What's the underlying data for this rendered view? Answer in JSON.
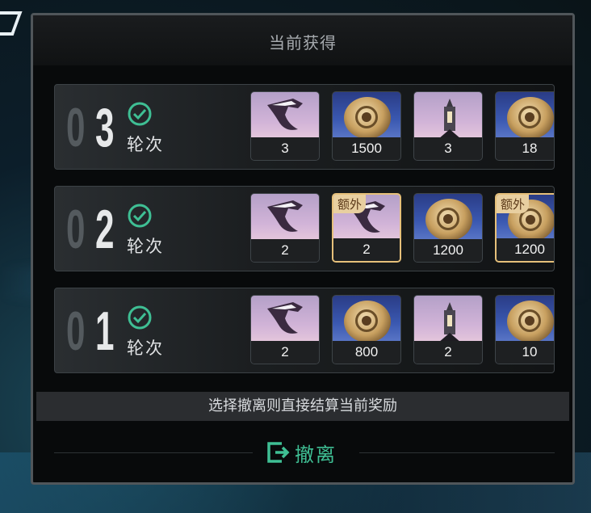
{
  "panel": {
    "title": "当前获得"
  },
  "rounds": [
    {
      "num_prefix": "0",
      "num": "3",
      "label": "轮次",
      "items": [
        {
          "icon": "claw-icon",
          "count": "3",
          "extra": ""
        },
        {
          "icon": "coin-icon",
          "count": "1500",
          "extra": ""
        },
        {
          "icon": "tower-icon",
          "count": "3",
          "extra": ""
        },
        {
          "icon": "coin-icon",
          "count": "18",
          "extra": ""
        }
      ]
    },
    {
      "num_prefix": "0",
      "num": "2",
      "label": "轮次",
      "items": [
        {
          "icon": "claw-icon",
          "count": "2",
          "extra": ""
        },
        {
          "icon": "claw-icon",
          "count": "2",
          "extra": "额外"
        },
        {
          "icon": "coin-icon",
          "count": "1200",
          "extra": ""
        },
        {
          "icon": "coin-icon",
          "count": "1200",
          "extra": "额外"
        }
      ]
    },
    {
      "num_prefix": "0",
      "num": "1",
      "label": "轮次",
      "items": [
        {
          "icon": "claw-icon",
          "count": "2",
          "extra": ""
        },
        {
          "icon": "coin-icon",
          "count": "800",
          "extra": ""
        },
        {
          "icon": "tower-icon",
          "count": "2",
          "extra": ""
        },
        {
          "icon": "coin-icon",
          "count": "10",
          "extra": ""
        }
      ]
    }
  ],
  "notice": "选择撤离则直接结算当前奖励",
  "evacuate": {
    "label": "撤离",
    "icon": "exit-icon"
  },
  "colors": {
    "accent": "#3fbf94",
    "extra_tag": "#e8cfa0"
  }
}
